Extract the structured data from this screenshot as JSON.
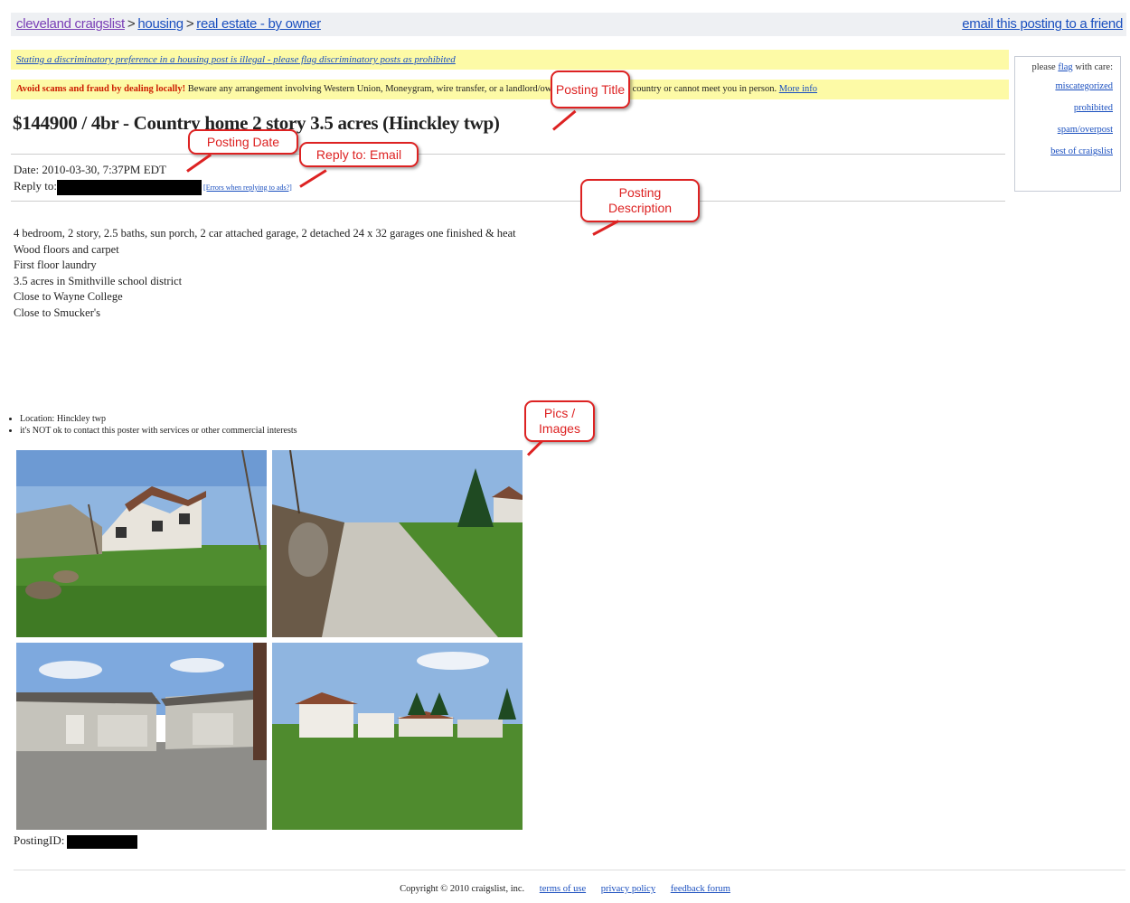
{
  "breadcrumb": {
    "home": "cleveland craigslist",
    "sep1": ">",
    "housing": "housing",
    "sep2": ">",
    "section": "real estate - by owner"
  },
  "email_link": "email this posting to a friend",
  "notice_discrimination": "Stating a discriminatory preference in a housing post is illegal - please flag discriminatory posts as prohibited",
  "notice_scam": {
    "bold": "Avoid scams and fraud by dealing locally!",
    "text": " Beware any arrangement involving Western Union, Moneygram, wire transfer, or a landlord/owner who is out of the country or cannot meet you in person. ",
    "more": "More info"
  },
  "flag_box": {
    "heading_pre": "please",
    "heading_link": "flag",
    "heading_post": "with care:",
    "items": [
      "miscategorized",
      "prohibited",
      "spam/overpost",
      "best of craigslist"
    ]
  },
  "title": "$144900 / 4br - Country home 2 story 3.5 acres (Hinckley twp)",
  "date_label": "Date:",
  "date_value": "2010-03-30, 7:37PM EDT",
  "reply_label": "Reply to:",
  "reply_link": "[Errors when replying to ads?]",
  "description": [
    "4 bedroom, 2 story, 2.5 baths, sun porch, 2 car attached garage, 2 detached 24 x 32 garages one finished & heat",
    "Wood floors and carpet",
    "First floor laundry",
    "3.5 acres in Smithville school district",
    "Close to Wayne College",
    "Close to Smucker's"
  ],
  "bullets": [
    "Location: Hinckley twp",
    "it's NOT ok to contact this poster with services or other commercial interests"
  ],
  "posting_id_label": "PostingID:",
  "footer": {
    "copyright": "Copyright © 2010 craigslist, inc.",
    "links": [
      "terms of use",
      "privacy policy",
      "feedback forum"
    ]
  },
  "callouts": {
    "title": "Posting Title",
    "date": "Posting Date",
    "reply": "Reply to: Email",
    "description": "Posting Description",
    "pics": "Pics / Images"
  },
  "colors": {
    "callout": "#dd2222",
    "notice_bg": "#fdfaa6",
    "link": "#1a4fbf"
  }
}
